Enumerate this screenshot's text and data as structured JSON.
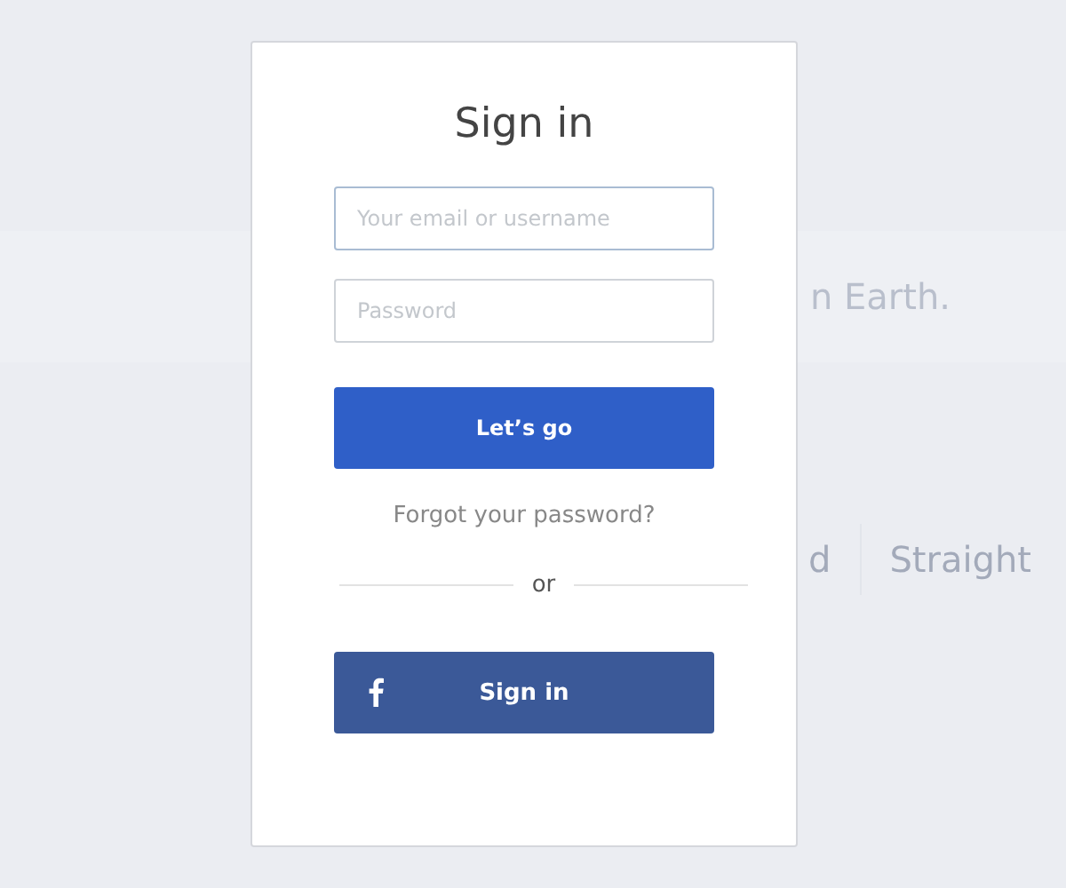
{
  "background": {
    "headline_fragment": "n Earth.",
    "options": [
      {
        "label": "d"
      },
      {
        "label": "Straight"
      }
    ]
  },
  "card": {
    "title": "Sign in",
    "fields": [
      {
        "placeholder": "Your email or username",
        "focused": true
      },
      {
        "placeholder": "Password",
        "focused": false
      }
    ],
    "submit": "Let’s go",
    "forgot_link": "Forgot your password?",
    "divider": "or",
    "facebook_button": "Sign in"
  }
}
